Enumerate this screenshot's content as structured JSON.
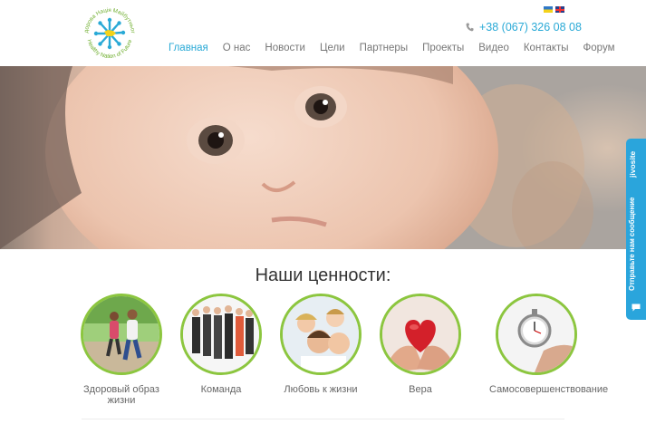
{
  "header": {
    "logo_text_top": "Здорова Нація Майбутнього",
    "logo_text_bottom": "Healthy Nation of Future",
    "phone": "+38 (067) 326 08 08",
    "flags": [
      "ua-flag",
      "en-flag"
    ]
  },
  "nav": {
    "items": [
      {
        "label": "Главная",
        "active": true
      },
      {
        "label": "О нас",
        "active": false
      },
      {
        "label": "Новости",
        "active": false
      },
      {
        "label": "Цели",
        "active": false
      },
      {
        "label": "Партнеры",
        "active": false
      },
      {
        "label": "Проекты",
        "active": false
      },
      {
        "label": "Видео",
        "active": false
      },
      {
        "label": "Контакты",
        "active": false
      },
      {
        "label": "Форум",
        "active": false
      }
    ]
  },
  "hero": {
    "image": "baby-portrait"
  },
  "chat": {
    "brand": "jivosite",
    "label": "Отправьте нам сообщение"
  },
  "values": {
    "title": "Наши ценности:",
    "items": [
      {
        "label": "Здоровый образ жизни",
        "image": "jogging-couple"
      },
      {
        "label": "Команда",
        "image": "business-team"
      },
      {
        "label": "Любовь к жизни",
        "image": "happy-family"
      },
      {
        "label": "Вера",
        "image": "heart-in-hands"
      },
      {
        "label": "Самосовершенствование",
        "image": "stopwatch-in-hand"
      }
    ]
  },
  "colors": {
    "accent": "#29a9d6",
    "circle_border": "#8cc63f",
    "chat_bg": "#2aa5dc"
  }
}
